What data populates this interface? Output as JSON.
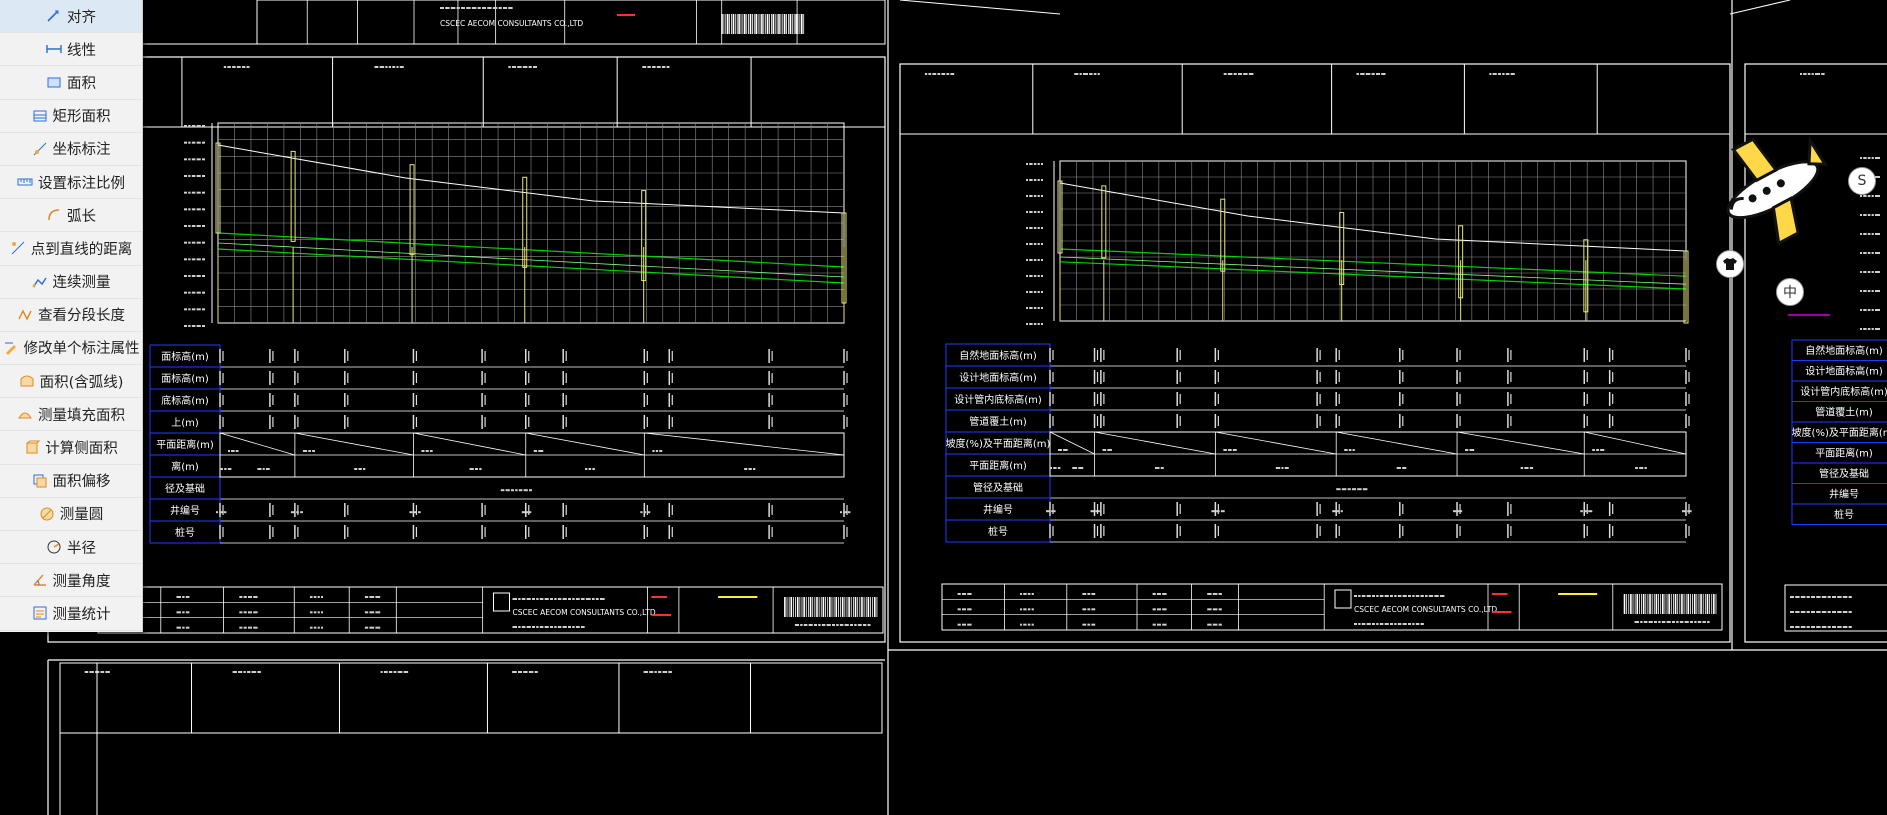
{
  "menu": {
    "items": [
      {
        "label": "对齐",
        "icon": "align-icon"
      },
      {
        "label": "线性",
        "icon": "linear-dimension-icon"
      },
      {
        "label": "面积",
        "icon": "area-icon"
      },
      {
        "label": "矩形面积",
        "icon": "rectangle-area-icon"
      },
      {
        "label": "坐标标注",
        "icon": "coordinate-icon"
      },
      {
        "label": "设置标注比例",
        "icon": "scale-icon"
      },
      {
        "label": "弧长",
        "icon": "arc-length-icon"
      },
      {
        "label": "点到直线的距离",
        "icon": "point-line-distance-icon"
      },
      {
        "label": "连续测量",
        "icon": "continuous-measure-icon"
      },
      {
        "label": "查看分段长度",
        "icon": "segment-length-icon"
      },
      {
        "label": "修改单个标注属性",
        "icon": "edit-annotation-icon"
      },
      {
        "label": "面积(含弧线)",
        "icon": "arc-area-icon"
      },
      {
        "label": "测量填充面积",
        "icon": "fill-area-icon"
      },
      {
        "label": "计算侧面积",
        "icon": "side-area-icon"
      },
      {
        "label": "面积偏移",
        "icon": "area-offset-icon"
      },
      {
        "label": "测量圆",
        "icon": "circle-icon"
      },
      {
        "label": "半径",
        "icon": "radius-icon"
      },
      {
        "label": "测量角度",
        "icon": "angle-icon"
      },
      {
        "label": "测量统计",
        "icon": "statistics-icon"
      }
    ]
  },
  "drawing": {
    "company_cn": "中国建筑上海设计研究院有限公司",
    "company_en": "CSCEC AECOM CONSULTANTS CO.,LTD",
    "profile_rows": [
      "自然地面标高(m)",
      "设计地面标高(m)",
      "设计管内底标高(m)",
      "管道覆土(m)",
      "坡度(%)及平面距离(m)",
      "平面距离(m)",
      "管径及基础",
      "井编号",
      "桩号"
    ],
    "cropped_rows_left": [
      "面标高(m)",
      "面标高(m)",
      "底标高(m)",
      "上(m)",
      "平面距离(m)",
      "离(m)",
      "径及基础",
      "井编号",
      "桩号"
    ]
  },
  "floating": {
    "btn_a": "中",
    "btn_s": "S"
  },
  "colors": {
    "background": "#000000",
    "line": "#ffffff",
    "grid": "#8c8c8c",
    "ground_line": "#00d200",
    "pipe_marker": "#e8e878",
    "row_border": "#1e3cff",
    "stamp_red": "#ff3030",
    "stamp_yellow": "#ffee33",
    "accent_magenta": "#ff00ff"
  }
}
